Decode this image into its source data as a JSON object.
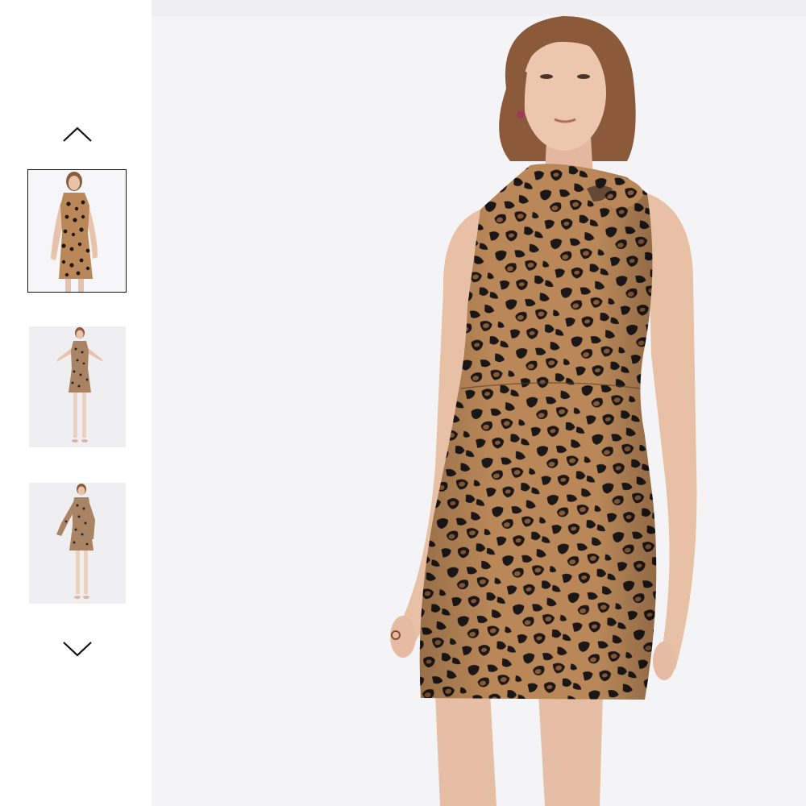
{
  "gallery": {
    "prev_icon": "chevron-up-icon",
    "next_icon": "chevron-down-icon",
    "selected_index": 1,
    "thumbnails": [
      {
        "view": "front-closeup",
        "selected": true
      },
      {
        "view": "front-full-length",
        "selected": false
      },
      {
        "view": "front-full-length-alt",
        "selected": false
      }
    ]
  },
  "colors": {
    "panel_bg": "#f4f3f5",
    "print_base": "#b98758",
    "print_spot": "#1c1717",
    "print_mid": "#8a5a35",
    "skin": "#e8c3ab",
    "hair": "#8b5a3a"
  }
}
